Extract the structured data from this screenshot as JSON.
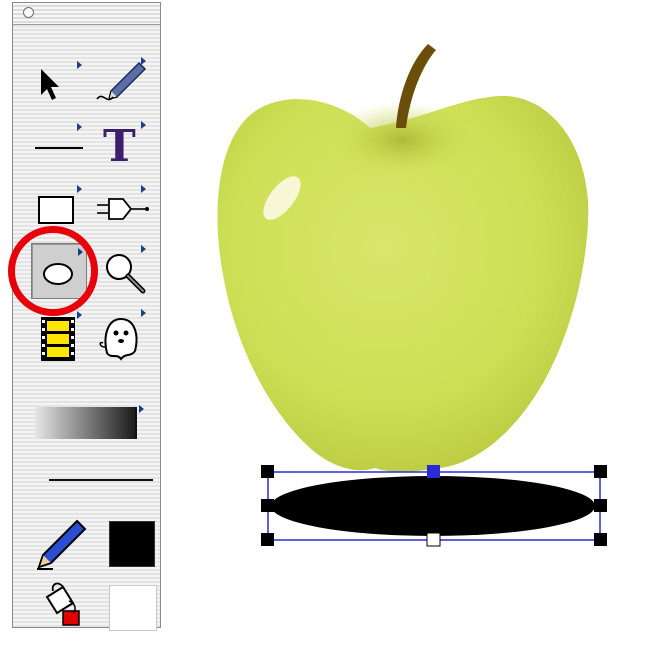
{
  "palette": {
    "title": "",
    "tools": [
      {
        "id": "arrow",
        "icon": "arrow-pointer-icon",
        "active": false
      },
      {
        "id": "pen",
        "icon": "pen-icon",
        "active": false
      },
      {
        "id": "line",
        "icon": "line-icon",
        "active": false
      },
      {
        "id": "text",
        "icon": "text-t-icon",
        "active": false,
        "glyph": "T"
      },
      {
        "id": "rectangle",
        "icon": "rectangle-icon",
        "active": false
      },
      {
        "id": "connector",
        "icon": "plug-connector-icon",
        "active": false
      },
      {
        "id": "ellipse",
        "icon": "ellipse-icon",
        "active": true
      },
      {
        "id": "zoom",
        "icon": "magnifier-icon",
        "active": false
      },
      {
        "id": "film",
        "icon": "film-strip-icon",
        "active": false
      },
      {
        "id": "ghost",
        "icon": "ghost-icon",
        "active": false
      }
    ],
    "fill_color": "#000000",
    "stroke_color": "#ffffff",
    "highlight_color": "#e8000b"
  },
  "canvas": {
    "apple_color": "#cddf55",
    "stem_color": "#6b4e0a",
    "selection_color": "#2b2bd6",
    "shadow_color": "#000000"
  }
}
